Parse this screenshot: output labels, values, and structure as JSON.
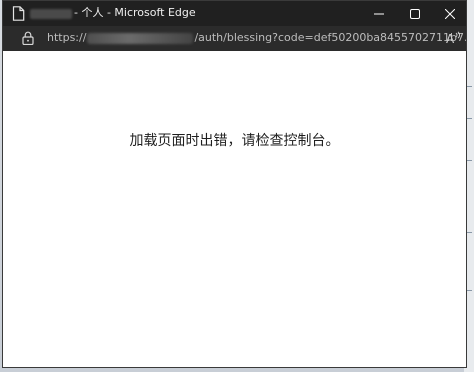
{
  "window": {
    "title_suffix": "- 个人 - Microsoft Edge"
  },
  "addressbar": {
    "url_prefix": "https://",
    "url_path": "/auth/blessing?code=def50200ba8455702711b7...",
    "read_aloud_label": "A"
  },
  "content": {
    "error_message": "加载页面时出错，请检查控制台。"
  },
  "icons": {
    "page": "page-icon",
    "lock": "lock-icon",
    "minimize": "minimize-icon",
    "maximize": "maximize-icon",
    "close": "close-icon",
    "read_aloud": "read-aloud-icon"
  },
  "colors": {
    "titlebar": "#202020",
    "addressbar": "#2b2b2b",
    "content_bg": "#ffffff"
  }
}
